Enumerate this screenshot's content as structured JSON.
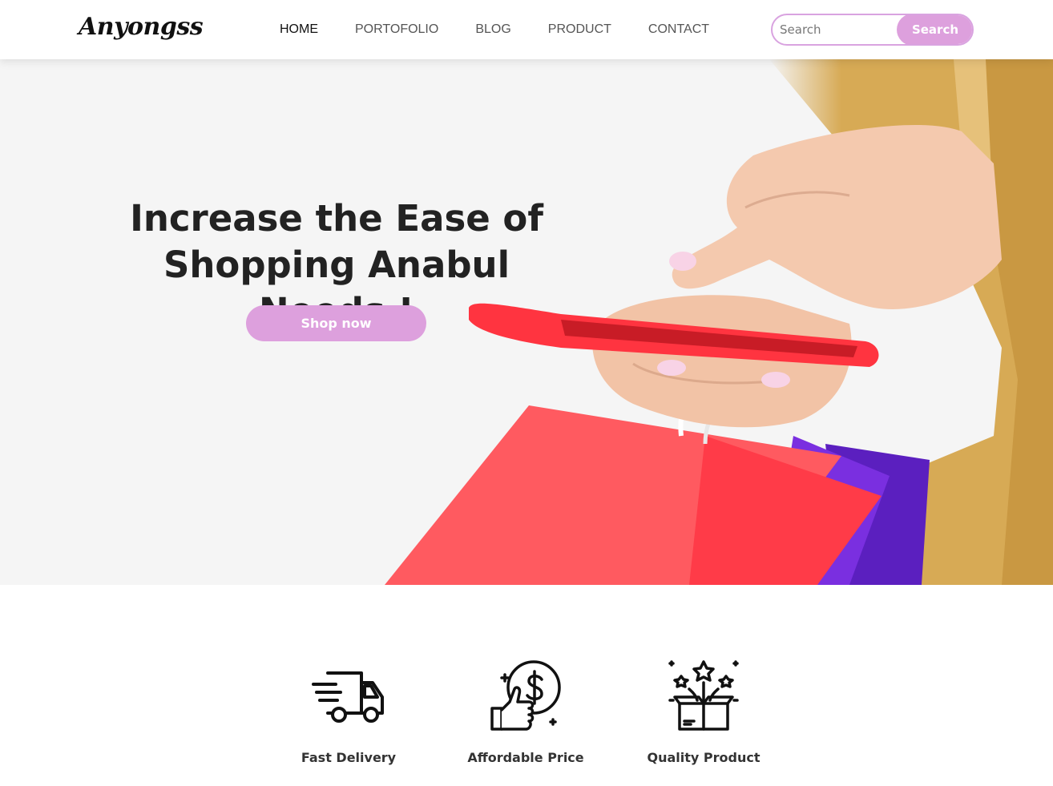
{
  "brand": {
    "logo_text": "Anyongss"
  },
  "nav": {
    "items": [
      {
        "label": "HOME",
        "active": true
      },
      {
        "label": "PORTOFOLIO",
        "active": false
      },
      {
        "label": "BLOG",
        "active": false
      },
      {
        "label": "PRODUCT",
        "active": false
      },
      {
        "label": "CONTACT",
        "active": false
      }
    ]
  },
  "search": {
    "placeholder": "Search",
    "value": "",
    "button_label": "Search"
  },
  "hero": {
    "title_line1": "Increase the Ease of",
    "title_line2": "Shopping Anabul Needs !",
    "cta_label": "Shop now"
  },
  "features": [
    {
      "label": "Fast Delivery",
      "icon": "delivery-truck-icon"
    },
    {
      "label": "Affordable Price",
      "icon": "thumbs-up-dollar-icon"
    },
    {
      "label": "Quality Product",
      "icon": "gift-box-stars-icon"
    }
  ],
  "colors": {
    "accent": "#dda0dd",
    "text": "#222222",
    "hero_bg": "#f5f5f5"
  }
}
